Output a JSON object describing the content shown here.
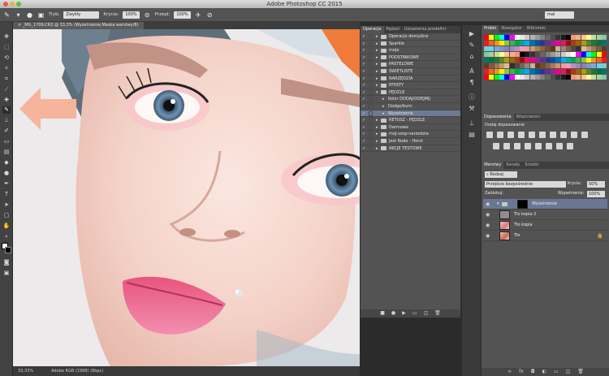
{
  "app": {
    "title": "Adobe Photoshop CC 2015"
  },
  "options_bar": {
    "mode_label": "Tryb:",
    "mode_value": "Zwykły",
    "opacity_label": "Krycie:",
    "opacity_value": "100%",
    "flow_label": "Przepł:",
    "flow_value": "100%",
    "workspace_value": "mal"
  },
  "document": {
    "tab_title": "_MG_1709.CR2 @ 33,3% (Wyostrzenie,Maska warstwy/8)",
    "zoom": "33,33%",
    "profile": "Adobe RGB (1998) (8bpc)"
  },
  "actions_panel": {
    "tabs": [
      "Operacje",
      "Pędzel",
      "Ustawienia predefini"
    ],
    "items": [
      {
        "label": "Operacje domyślne",
        "type": "folder",
        "level": 0,
        "selected": false
      },
      {
        "label": "Sparkle",
        "type": "folder",
        "level": 0,
        "selected": false
      },
      {
        "label": "moje",
        "type": "folder",
        "level": 0,
        "selected": false
      },
      {
        "label": "PODSTAWOWE",
        "type": "folder",
        "level": 0,
        "selected": false
      },
      {
        "label": "PASTELOWE",
        "type": "folder",
        "level": 0,
        "selected": false
      },
      {
        "label": "ŚWIETLISTE",
        "type": "folder",
        "level": 0,
        "selected": false
      },
      {
        "label": "NARZĘDZIA",
        "type": "folder",
        "level": 0,
        "selected": false
      },
      {
        "label": "EFEKTY",
        "type": "folder",
        "level": 0,
        "selected": false
      },
      {
        "label": "PĘDZLE",
        "type": "folder-open",
        "level": 0,
        "selected": false
      },
      {
        "label": "Kolor DODAJ/ODEJMIJ",
        "type": "action",
        "level": 1,
        "selected": false
      },
      {
        "label": "Dodge/burn",
        "type": "action",
        "level": 1,
        "selected": false
      },
      {
        "label": "Wyostrzenie",
        "type": "action",
        "level": 1,
        "selected": true
      },
      {
        "label": "RETUSZ - PĘDZLE",
        "type": "folder",
        "level": 0,
        "selected": false
      },
      {
        "label": "Darmowe",
        "type": "folder",
        "level": 0,
        "selected": false
      },
      {
        "label": "moj-szop-narzedzia",
        "type": "folder",
        "level": 0,
        "selected": false
      },
      {
        "label": "Jest Rudo - Horst",
        "type": "folder",
        "level": 0,
        "selected": false
      },
      {
        "label": "AKCJE TESTOWE",
        "type": "folder",
        "level": 0,
        "selected": false
      }
    ]
  },
  "swatches_panel": {
    "tabs": [
      "Próbki",
      "Nawigator",
      "Biblioteki"
    ]
  },
  "adjustments_panel": {
    "tabs": [
      "Dopasowania",
      "Właściwości"
    ],
    "title": "Dodaj dopasowanie"
  },
  "layers_panel": {
    "tabs": [
      "Warstwy",
      "Kanały",
      "Ścieżki"
    ],
    "filter_value": "Rodzaj",
    "blend_mode": "Przejście bezpośrednie",
    "opacity_label": "Krycie:",
    "opacity_value": "50%",
    "lock_label": "Zablokuj:",
    "fill_label": "Wypełnienie:",
    "fill_value": "100%",
    "layers": [
      {
        "name": "Wyostrzenie",
        "selected": true,
        "kind": "group-mask"
      },
      {
        "name": "Tło kopia 2",
        "selected": false,
        "kind": "gray"
      },
      {
        "name": "Tło kopia",
        "selected": false,
        "kind": "photo"
      },
      {
        "name": "Tło",
        "selected": false,
        "kind": "photo-locked"
      }
    ]
  },
  "colors": {
    "accent_selected": "#6c7a95",
    "arrow_overlay": "#f6b49c",
    "panel_bg": "#535353"
  }
}
